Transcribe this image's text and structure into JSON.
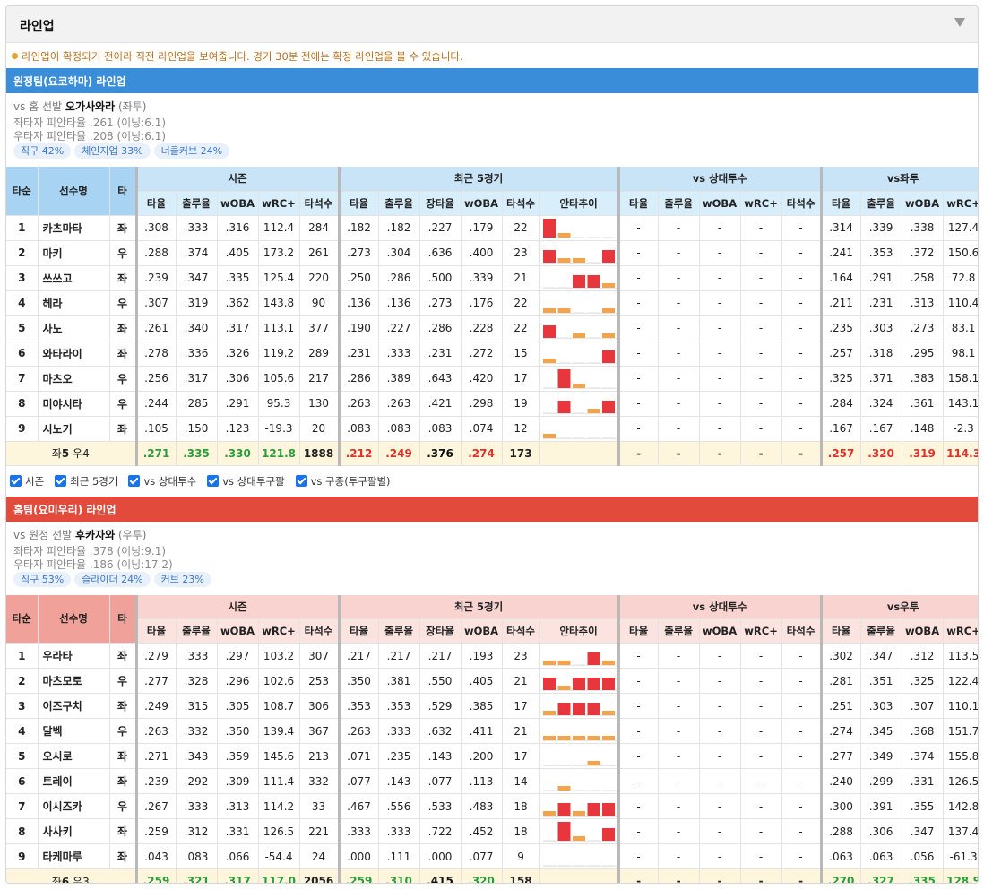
{
  "header": {
    "title": "라인업"
  },
  "notice": "라인업이 확정되기 전이라 직전 라인업을 보여줍니다. 경기 30분 전에는 확정 라인업을 볼 수 있습니다.",
  "colors": {
    "blue": "#3a8dd8",
    "red": "#e24b3c",
    "bar_red": "#e8363d",
    "bar_orange": "#f2a44d"
  },
  "checkboxes": [
    "시즌",
    "최근 5경기",
    "vs 상대투수",
    "vs 상대투구팔",
    "vs 구종(투구팔별)"
  ],
  "headers": {
    "order": "타순",
    "name": "선수명",
    "hand": "타",
    "season": "시즌",
    "recent": "최근 5경기",
    "vs_pitcher": "vs 상대투수",
    "season_cols": [
      "타율",
      "출루율",
      "wOBA",
      "wRC+",
      "타석수"
    ],
    "recent_cols": [
      "타율",
      "출루율",
      "장타율",
      "wOBA",
      "타석수",
      "안타추이"
    ],
    "vsp_cols": [
      "타율",
      "출루율",
      "wOBA",
      "wRC+",
      "타석수"
    ],
    "split_cols": [
      "타율",
      "출루율",
      "wOBA",
      "wRC+"
    ]
  },
  "away": {
    "title": "원정팀(요코하마) 라인업",
    "starter_prefix": "vs 홈 선발",
    "starter": "오가사와라",
    "starter_hand": "(좌투)",
    "line2": "좌타자 피안타율 .261 (이닝:6.1)",
    "line3": "우타자 피안타율 .208 (이닝:6.1)",
    "pills": [
      "직구 42%",
      "체인지업 33%",
      "너클커브 24%"
    ],
    "split_title": "vs좌투",
    "rows": [
      {
        "o": "1",
        "n": "카츠마타",
        "h": "좌",
        "s": [
          ".308",
          ".333",
          ".316",
          "112.4",
          "284"
        ],
        "r": [
          ".182",
          ".182",
          ".227",
          ".179",
          "22"
        ],
        "t": [
          3,
          1,
          0,
          0,
          0
        ],
        "v": [
          "-",
          "-",
          "-",
          "-",
          "-"
        ],
        "x": [
          ".314",
          ".339",
          ".338",
          "127.4"
        ]
      },
      {
        "o": "2",
        "n": "마키",
        "h": "우",
        "s": [
          ".288",
          ".374",
          ".405",
          "173.2",
          "261"
        ],
        "r": [
          ".273",
          ".304",
          ".636",
          ".400",
          "23"
        ],
        "t": [
          2,
          1,
          1,
          0,
          2
        ],
        "v": [
          "-",
          "-",
          "-",
          "-",
          "-"
        ],
        "x": [
          ".241",
          ".353",
          ".372",
          "150.6"
        ]
      },
      {
        "o": "3",
        "n": "쓰쓰고",
        "h": "좌",
        "s": [
          ".239",
          ".347",
          ".335",
          "125.4",
          "220"
        ],
        "r": [
          ".250",
          ".286",
          ".500",
          ".339",
          "21"
        ],
        "t": [
          0,
          0,
          2,
          2,
          1
        ],
        "v": [
          "-",
          "-",
          "-",
          "-",
          "-"
        ],
        "x": [
          ".164",
          ".291",
          ".258",
          "72.8"
        ]
      },
      {
        "o": "4",
        "n": "헤라",
        "h": "우",
        "s": [
          ".307",
          ".319",
          ".362",
          "143.8",
          "90"
        ],
        "r": [
          ".136",
          ".136",
          ".273",
          ".176",
          "22"
        ],
        "t": [
          1,
          1,
          0,
          0,
          1
        ],
        "v": [
          "-",
          "-",
          "-",
          "-",
          "-"
        ],
        "x": [
          ".211",
          ".231",
          ".313",
          "110.4"
        ]
      },
      {
        "o": "5",
        "n": "사노",
        "h": "좌",
        "s": [
          ".261",
          ".340",
          ".317",
          "113.1",
          "377"
        ],
        "r": [
          ".190",
          ".227",
          ".286",
          ".228",
          "22"
        ],
        "t": [
          2,
          0,
          1,
          0,
          1
        ],
        "v": [
          "-",
          "-",
          "-",
          "-",
          "-"
        ],
        "x": [
          ".235",
          ".303",
          ".273",
          "83.1"
        ]
      },
      {
        "o": "6",
        "n": "와타라이",
        "h": "좌",
        "s": [
          ".278",
          ".336",
          ".326",
          "119.2",
          "289"
        ],
        "r": [
          ".231",
          ".333",
          ".231",
          ".272",
          "15"
        ],
        "t": [
          1,
          0,
          0,
          0,
          2
        ],
        "v": [
          "-",
          "-",
          "-",
          "-",
          "-"
        ],
        "x": [
          ".257",
          ".318",
          ".295",
          "98.1"
        ]
      },
      {
        "o": "7",
        "n": "마츠오",
        "h": "우",
        "s": [
          ".256",
          ".317",
          ".306",
          "105.6",
          "217"
        ],
        "r": [
          ".286",
          ".389",
          ".643",
          ".420",
          "17"
        ],
        "t": [
          0,
          3,
          1,
          0,
          0
        ],
        "v": [
          "-",
          "-",
          "-",
          "-",
          "-"
        ],
        "x": [
          ".325",
          ".371",
          ".383",
          "158.1"
        ]
      },
      {
        "o": "8",
        "n": "미야시타",
        "h": "우",
        "s": [
          ".244",
          ".285",
          ".291",
          "95.3",
          "130"
        ],
        "r": [
          ".263",
          ".263",
          ".421",
          ".298",
          "19"
        ],
        "t": [
          0,
          2,
          0,
          1,
          2
        ],
        "v": [
          "-",
          "-",
          "-",
          "-",
          "-"
        ],
        "x": [
          ".284",
          ".324",
          ".361",
          "143.1"
        ]
      },
      {
        "o": "9",
        "n": "시노기",
        "h": "좌",
        "s": [
          ".105",
          ".150",
          ".123",
          "-19.3",
          "20"
        ],
        "r": [
          ".083",
          ".083",
          ".083",
          ".074",
          "12"
        ],
        "t": [
          1,
          0,
          0,
          0,
          0
        ],
        "v": [
          "-",
          "-",
          "-",
          "-",
          "-"
        ],
        "x": [
          ".167",
          ".167",
          ".148",
          "-2.3"
        ]
      }
    ],
    "summary": {
      "label_prefix": "좌",
      "left": "5",
      "mid": " 우",
      "right": "4",
      "s": [
        ".271",
        ".335",
        ".330",
        "121.8",
        "1888"
      ],
      "r": [
        ".212",
        ".249",
        ".376",
        ".274",
        "173"
      ],
      "v": [
        "-",
        "-",
        "-",
        "-",
        "-"
      ],
      "x": [
        ".257",
        ".320",
        ".319",
        "114.3"
      ]
    }
  },
  "home": {
    "title": "홈팀(요미우리) 라인업",
    "starter_prefix": "vs 원정 선발",
    "starter": "후카자와",
    "starter_hand": "(우투)",
    "line2": "좌타자 피안타율 .378 (이닝:9.1)",
    "line3": "우타자 피안타율 .186 (이닝:17.2)",
    "pills": [
      "직구 53%",
      "슬라이더 24%",
      "커브 23%"
    ],
    "split_title": "vs우투",
    "rows": [
      {
        "o": "1",
        "n": "우라타",
        "h": "좌",
        "s": [
          ".279",
          ".333",
          ".297",
          "103.2",
          "307"
        ],
        "r": [
          ".217",
          ".217",
          ".217",
          ".193",
          "23"
        ],
        "t": [
          1,
          1,
          0,
          2,
          1
        ],
        "v": [
          "-",
          "-",
          "-",
          "-",
          "-"
        ],
        "x": [
          ".302",
          ".347",
          ".312",
          "113.5"
        ]
      },
      {
        "o": "2",
        "n": "마츠모토",
        "h": "우",
        "s": [
          ".277",
          ".328",
          ".296",
          "102.6",
          "253"
        ],
        "r": [
          ".350",
          ".381",
          ".550",
          ".405",
          "21"
        ],
        "t": [
          2,
          1,
          2,
          2,
          2
        ],
        "v": [
          "-",
          "-",
          "-",
          "-",
          "-"
        ],
        "x": [
          ".281",
          ".351",
          ".325",
          "122.4"
        ]
      },
      {
        "o": "3",
        "n": "이즈구치",
        "h": "좌",
        "s": [
          ".249",
          ".315",
          ".305",
          "108.7",
          "306"
        ],
        "r": [
          ".353",
          ".353",
          ".529",
          ".385",
          "17"
        ],
        "t": [
          1,
          2,
          2,
          2,
          1
        ],
        "v": [
          "-",
          "-",
          "-",
          "-",
          "-"
        ],
        "x": [
          ".251",
          ".303",
          ".307",
          "110.1"
        ]
      },
      {
        "o": "4",
        "n": "달벡",
        "h": "우",
        "s": [
          ".263",
          ".332",
          ".350",
          "139.4",
          "367"
        ],
        "r": [
          ".263",
          ".333",
          ".632",
          ".411",
          "21"
        ],
        "t": [
          1,
          1,
          1,
          1,
          1
        ],
        "v": [
          "-",
          "-",
          "-",
          "-",
          "-"
        ],
        "x": [
          ".274",
          ".345",
          ".368",
          "151.7"
        ]
      },
      {
        "o": "5",
        "n": "오시로",
        "h": "좌",
        "s": [
          ".271",
          ".343",
          ".359",
          "145.6",
          "213"
        ],
        "r": [
          ".071",
          ".235",
          ".143",
          ".200",
          "17"
        ],
        "t": [
          0,
          0,
          0,
          1,
          0
        ],
        "v": [
          "-",
          "-",
          "-",
          "-",
          "-"
        ],
        "x": [
          ".277",
          ".349",
          ".374",
          "155.8"
        ]
      },
      {
        "o": "6",
        "n": "트레이",
        "h": "좌",
        "s": [
          ".239",
          ".292",
          ".309",
          "111.4",
          "332"
        ],
        "r": [
          ".077",
          ".143",
          ".077",
          ".113",
          "14"
        ],
        "t": [
          0,
          1,
          0,
          0,
          0
        ],
        "v": [
          "-",
          "-",
          "-",
          "-",
          "-"
        ],
        "x": [
          ".240",
          ".299",
          ".331",
          "126.5"
        ]
      },
      {
        "o": "7",
        "n": "이시즈카",
        "h": "우",
        "s": [
          ".267",
          ".333",
          ".313",
          "114.2",
          "33"
        ],
        "r": [
          ".467",
          ".556",
          ".533",
          ".483",
          "18"
        ],
        "t": [
          1,
          2,
          1,
          2,
          2
        ],
        "v": [
          "-",
          "-",
          "-",
          "-",
          "-"
        ],
        "x": [
          ".300",
          ".391",
          ".355",
          "142.8"
        ]
      },
      {
        "o": "8",
        "n": "사사키",
        "h": "좌",
        "s": [
          ".259",
          ".312",
          ".331",
          "126.5",
          "221"
        ],
        "r": [
          ".333",
          ".333",
          ".722",
          ".452",
          "18"
        ],
        "t": [
          0,
          3,
          1,
          0,
          2
        ],
        "v": [
          "-",
          "-",
          "-",
          "-",
          "-"
        ],
        "x": [
          ".288",
          ".306",
          ".347",
          "137.4"
        ]
      },
      {
        "o": "9",
        "n": "타케마루",
        "h": "좌",
        "s": [
          ".043",
          ".083",
          ".066",
          "-54.4",
          "24"
        ],
        "r": [
          ".000",
          ".111",
          ".000",
          ".077",
          "9"
        ],
        "t": [
          0,
          0,
          0,
          0,
          0
        ],
        "v": [
          "-",
          "-",
          "-",
          "-",
          "-"
        ],
        "x": [
          ".063",
          ".063",
          ".056",
          "-61.3"
        ]
      }
    ],
    "summary": {
      "label_prefix": "좌",
      "left": "6",
      "mid": " 우",
      "right": "3",
      "s": [
        ".259",
        ".321",
        ".317",
        "117.0",
        "2056"
      ],
      "r": [
        ".259",
        ".310",
        ".415",
        ".320",
        "158"
      ],
      "v": [
        "-",
        "-",
        "-",
        "-",
        "-"
      ],
      "x": [
        ".270",
        ".327",
        ".335",
        "128.9"
      ]
    }
  }
}
